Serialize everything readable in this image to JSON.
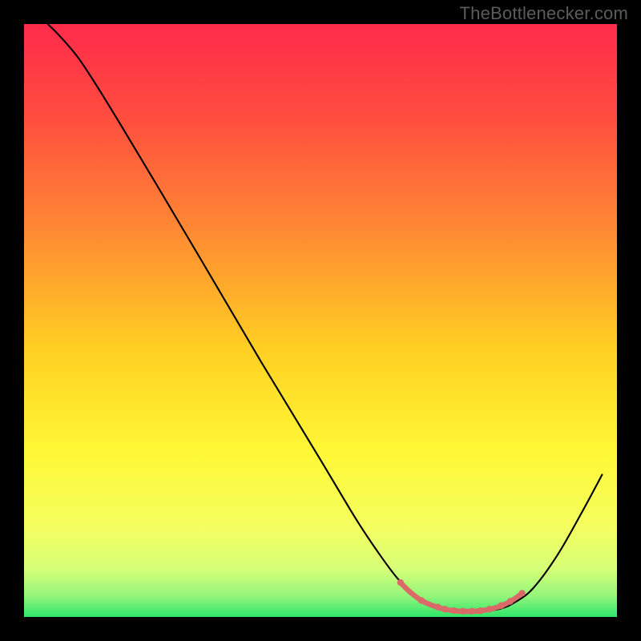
{
  "watermark": "TheBottlenecker.com",
  "chart_data": {
    "type": "line",
    "title": "",
    "xlabel": "",
    "ylabel": "",
    "xlim": [
      0,
      100
    ],
    "ylim": [
      0,
      100
    ],
    "gradient_stops": [
      {
        "offset": 0.0,
        "color": "#ff2b4b"
      },
      {
        "offset": 0.15,
        "color": "#ff4b3f"
      },
      {
        "offset": 0.35,
        "color": "#ff8a33"
      },
      {
        "offset": 0.55,
        "color": "#ffd022"
      },
      {
        "offset": 0.72,
        "color": "#fff835"
      },
      {
        "offset": 0.85,
        "color": "#f4ff60"
      },
      {
        "offset": 0.92,
        "color": "#d6ff78"
      },
      {
        "offset": 0.965,
        "color": "#93f57a"
      },
      {
        "offset": 1.0,
        "color": "#2ee66b"
      }
    ],
    "series": [
      {
        "name": "bottleneck-curve",
        "color": "#000000",
        "stroke_width": 2.1,
        "points": [
          {
            "x": 4.0,
            "y": 100.0
          },
          {
            "x": 6.0,
            "y": 98.0
          },
          {
            "x": 9.0,
            "y": 94.5
          },
          {
            "x": 12.0,
            "y": 90.0
          },
          {
            "x": 16.0,
            "y": 83.5
          },
          {
            "x": 22.0,
            "y": 73.5
          },
          {
            "x": 30.0,
            "y": 60.0
          },
          {
            "x": 40.0,
            "y": 43.0
          },
          {
            "x": 50.0,
            "y": 26.5
          },
          {
            "x": 56.0,
            "y": 16.5
          },
          {
            "x": 60.0,
            "y": 10.5
          },
          {
            "x": 63.0,
            "y": 6.5
          },
          {
            "x": 66.0,
            "y": 3.5
          },
          {
            "x": 69.0,
            "y": 1.8
          },
          {
            "x": 72.0,
            "y": 1.0
          },
          {
            "x": 76.0,
            "y": 0.9
          },
          {
            "x": 80.0,
            "y": 1.3
          },
          {
            "x": 83.0,
            "y": 2.6
          },
          {
            "x": 86.0,
            "y": 5.0
          },
          {
            "x": 90.0,
            "y": 10.5
          },
          {
            "x": 94.0,
            "y": 17.5
          },
          {
            "x": 97.5,
            "y": 24.0
          }
        ]
      },
      {
        "name": "flat-region-marker",
        "color": "#da6a67",
        "stroke_width": 6.5,
        "points": [
          {
            "x": 63.5,
            "y": 5.8
          },
          {
            "x": 65.0,
            "y": 4.3
          },
          {
            "x": 67.0,
            "y": 2.8
          },
          {
            "x": 69.0,
            "y": 1.9
          },
          {
            "x": 71.0,
            "y": 1.3
          },
          {
            "x": 73.0,
            "y": 1.0
          },
          {
            "x": 75.0,
            "y": 0.95
          },
          {
            "x": 77.0,
            "y": 1.05
          },
          {
            "x": 79.0,
            "y": 1.4
          },
          {
            "x": 81.0,
            "y": 2.1
          },
          {
            "x": 82.5,
            "y": 2.9
          },
          {
            "x": 84.0,
            "y": 4.0
          }
        ],
        "dot_radius": 4.2,
        "dot_xs": [
          63.5,
          67.0,
          69.8,
          71.0,
          72.5,
          74.0,
          75.5,
          77.0,
          78.5,
          80.5,
          82.0,
          84.0
        ]
      }
    ]
  }
}
